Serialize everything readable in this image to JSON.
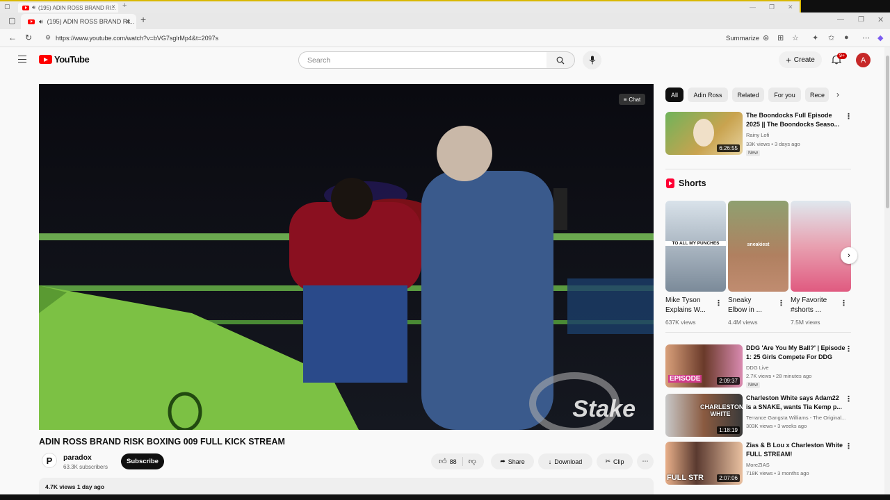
{
  "outer_tab": {
    "title": "(195) ADIN ROSS BRAND RI..."
  },
  "inner_tab": {
    "title": "(195) ADIN ROSS BRAND RI..."
  },
  "address_bar": {
    "url": "https://www.youtube.com/watch?v=bVG7sglrMp4&t=2097s",
    "summarize": "Summarize"
  },
  "header": {
    "logo_text": "YouTube",
    "search_placeholder": "Search",
    "create_label": "Create",
    "notif_count": "9+",
    "avatar_initial": "A"
  },
  "video": {
    "chat_label": "Chat",
    "watermark": "Stake",
    "title": "ADIN ROSS BRAND RISK BOXING 009 FULL KICK STREAM"
  },
  "channel": {
    "avatar_letter": "P",
    "name": "paradox",
    "subscribers": "63.3K subscribers",
    "subscribe_label": "Subscribe"
  },
  "actions": {
    "likes": "88",
    "share": "Share",
    "download": "Download",
    "clip": "Clip"
  },
  "description": {
    "meta": "4.7K views  1 day ago"
  },
  "chips": [
    "All",
    "Adin Ross",
    "Related",
    "For you",
    "Rece"
  ],
  "top_rec": {
    "title_l1": "The Boondocks Full Episode",
    "title_l2": "2025 || The Boondocks Seaso...",
    "channel": "Rainy Lofi",
    "meta": "33K views • 3 days ago",
    "badge": "New",
    "duration": "6:26:55"
  },
  "shorts": {
    "heading": "Shorts",
    "items": [
      {
        "title_l1": "Mike Tyson",
        "title_l2": "Explains W...",
        "views": "637K views",
        "overlay": "TO ALL MY PUNCHES"
      },
      {
        "title_l1": "Sneaky",
        "title_l2": "Elbow in ...",
        "views": "4.4M views",
        "overlay": "sneakiest"
      },
      {
        "title_l1": "My Favorite",
        "title_l2": "#shorts ...",
        "views": "7.5M views",
        "overlay": ""
      }
    ]
  },
  "recs": [
    {
      "title_l1": "DDG 'Are You My Ball?' | Episode",
      "title_l2": "1: 25 Girls Compete For DDG",
      "channel": "DDG Live",
      "meta": "2.7K views • 28 minutes ago",
      "badge": "New",
      "duration": "2:09:37",
      "overlay": "EPISODE"
    },
    {
      "title_l1": "Charleston White says Adam22",
      "title_l2": "is a SNAKE, wants Tia Kemp p...",
      "channel": "Terrance Gangsta Williams - The Original...",
      "meta": "303K views • 3 weeks ago",
      "badge": "",
      "duration": "1:18:19",
      "overlay": "CHARLESTON WHITE"
    },
    {
      "title_l1": "Zias & B Lou x Charleston White",
      "title_l2": "FULL STREAM!",
      "channel": "MoreZIAS",
      "meta": "718K views • 3 months ago",
      "badge": "",
      "duration": "2:07:06",
      "overlay": "FULL STR"
    }
  ],
  "colors": {
    "yt_red": "#ff0000",
    "accent_gold": "#d9b800",
    "subscribe_bg": "#0f0f0f"
  }
}
